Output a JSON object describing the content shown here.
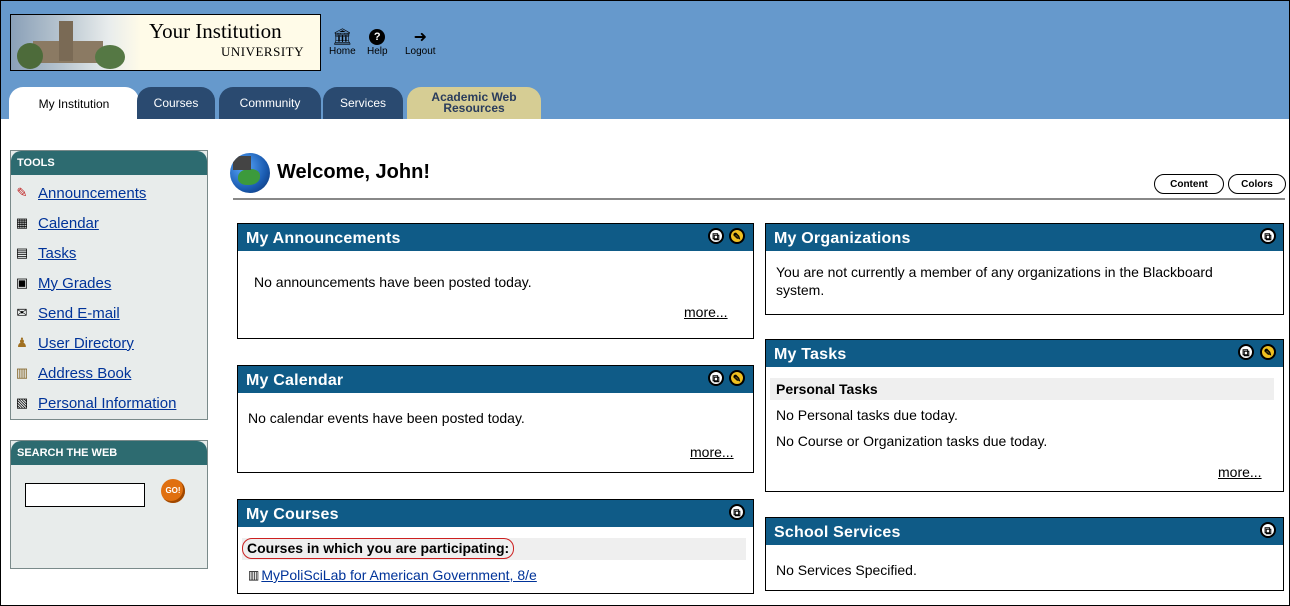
{
  "header": {
    "institution": "Your Institution",
    "institution_sub": "UNIVERSITY",
    "nav": [
      {
        "label": "Home",
        "icon": "home-icon"
      },
      {
        "label": "Help",
        "icon": "help-icon"
      },
      {
        "label": "Logout",
        "icon": "logout-icon"
      }
    ],
    "tabs": [
      "My Institution",
      "Courses",
      "Community",
      "Services",
      "Academic Web Resources"
    ]
  },
  "sidebar": {
    "tools_title": "TOOLS",
    "tools": [
      {
        "label": "Announcements",
        "icon": "pushpin-icon"
      },
      {
        "label": "Calendar",
        "icon": "calendar-icon"
      },
      {
        "label": "Tasks",
        "icon": "clipboard-icon"
      },
      {
        "label": "My Grades",
        "icon": "grades-icon"
      },
      {
        "label": "Send E-mail",
        "icon": "envelope-icon"
      },
      {
        "label": "User Directory",
        "icon": "users-icon"
      },
      {
        "label": "Address Book",
        "icon": "address-book-icon"
      },
      {
        "label": "Personal Information",
        "icon": "id-card-icon"
      }
    ],
    "search_title": "SEARCH THE WEB",
    "search_value": "",
    "go_label": "GO!"
  },
  "welcome": {
    "title": "Welcome, John!",
    "content_button": "Content",
    "colors_button": "Colors"
  },
  "modules": {
    "announcements": {
      "title": "My Announcements",
      "text": "No announcements have been posted today.",
      "more": "more..."
    },
    "calendar": {
      "title": "My Calendar",
      "text": "No calendar events have been posted today.",
      "more": "more..."
    },
    "courses": {
      "title": "My Courses",
      "subhead": "Courses in which you are participating:",
      "course": "MyPoliSciLab for American Government, 8/e"
    },
    "organizations": {
      "title": "My Organizations",
      "text": "You are not currently a member of any organizations in the Blackboard system."
    },
    "tasks": {
      "title": "My Tasks",
      "subhead": "Personal Tasks",
      "line1": "No Personal tasks due today.",
      "line2": "No Course or Organization tasks due today.",
      "more": "more..."
    },
    "services": {
      "title": "School Services",
      "text": "No Services Specified."
    }
  },
  "colors": {
    "header_bg": "#6699cc",
    "module_head": "#0f5b87",
    "sidebar_head": "#2d6b70",
    "link": "#003399"
  }
}
